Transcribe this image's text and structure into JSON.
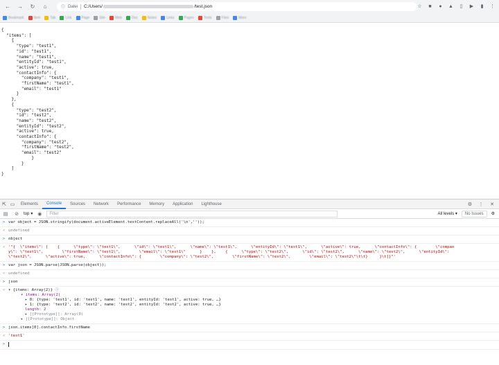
{
  "browser": {
    "site_label": "Datei",
    "url_prefix": "C:/Users/",
    "url_suffix": "/test.json",
    "bookmarks": [
      {
        "label": "Bookmark",
        "color": "#4285f4"
      },
      {
        "label": "Item",
        "color": "#ea4335"
      },
      {
        "label": "Tab",
        "color": "#fbbc04"
      },
      {
        "label": "Link",
        "color": "#34a853"
      },
      {
        "label": "Page",
        "color": "#4285f4"
      },
      {
        "label": "Site",
        "color": "#9aa0a6"
      },
      {
        "label": "Web",
        "color": "#ea4335"
      },
      {
        "label": "Doc",
        "color": "#34a853"
      },
      {
        "label": "Notes",
        "color": "#fbbc04"
      },
      {
        "label": "Links",
        "color": "#4285f4"
      },
      {
        "label": "Pages",
        "color": "#34a853"
      },
      {
        "label": "Tools",
        "color": "#ea4335"
      },
      {
        "label": "Files",
        "color": "#9aa0a6"
      },
      {
        "label": "More",
        "color": "#4285f4"
      }
    ]
  },
  "json_text": "{\n  \"items\": [\n    {\n      \"type\": \"test1\",\n      \"id\": \"test1\",\n      \"name\": \"test1\",\n      \"entityId\": \"test1\",\n      \"active\": true,\n      \"contactInfo\": {\n        \"company\": \"test1\",\n        \"firstName\": \"test1\",\n        \"email\": \"test1\"\n      }\n    },\n    {\n      \"type\": \"test2\",\n      \"id\": \"test2\",\n      \"name\": \"test2\",\n      \"entityId\": \"test2\",\n      \"active\": true,\n      \"contactInfo\": {\n        \"company\": \"test2\",\n        \"firstName\": \"test2\",\n        \"email\": \"test2\"\n            }\n        }\n    ]\n}",
  "devtools": {
    "tabs": [
      "Elements",
      "Console",
      "Sources",
      "Network",
      "Performance",
      "Memory",
      "Application",
      "Lighthouse"
    ],
    "active_tab": "Console",
    "context": "top",
    "filter_placeholder": "Filter",
    "levels_label": "All levels",
    "issues_label": "No Issues"
  },
  "console": {
    "cmd1": "var object = JSON.stringify(document.activeElement.textContent.replaceAll('\\n',''));",
    "undefined": "undefined",
    "cmd2": "object",
    "out2": "'\"{  \\\"items\\\": [    {      \\\"type\\\": \\\"test1\\\",      \\\"id\\\": \\\"test1\\\",      \\\"name\\\": \\\"test1\\\",      \\\"entityId\\\": \\\"test1\\\",      \\\"active\\\": true,      \\\"contactInfo\\\": {        \\\"compan",
    "out2b": "y\\\": \\\"test1\\\",        \\\"firstName\\\": \\\"test1\\\",        \\\"email\\\": \\\"test1\\\"      }    },    {      \\\"type\\\": \\\"test2\\\",      \\\"id\\\": \\\"test2\\\",      \\\"name\\\": \\\"test2\\\",      \\\"entityId\\\":",
    "out2c": "\\\"test2\\\",      \\\"active\\\": true,      \\\"contactInfo\\\": {        \\\"company\\\": \\\"test2\\\",        \\\"firstName\\\": \\\"test2\\\",        \\\"email\\\": \\\"test2\\\"\\t\\t}     }\\t]}\"'",
    "cmd3": "var json = JSON.parse(JSON.parse(object));",
    "cmd4": "json",
    "obj_summary": "{items: Array(2)}",
    "items_label": "items: Array(2)",
    "item0": "0: {type: 'test1', id: 'test1', name: 'test1', entityId: 'test1', active: true, …}",
    "item1": "1: {type: 'test2', id: 'test2', name: 'test2', entityId: 'test2', active: true, …}",
    "length": "length: 2",
    "proto_array": "[[Prototype]]: Array(0)",
    "proto_obj": "[[Prototype]]: Object",
    "cmd5": "json.items[0].contactInfo.firstName",
    "out5": "'test1'"
  }
}
